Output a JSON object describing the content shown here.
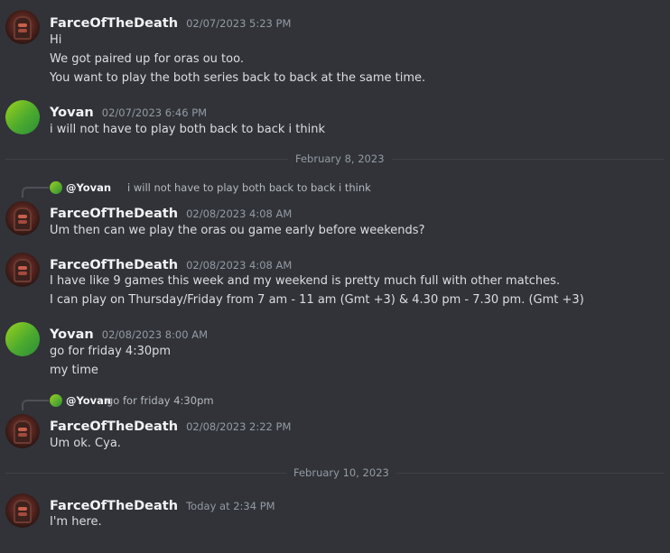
{
  "messages": {
    "m1": {
      "author": "FarceOfTheDeath",
      "timestamp": "02/07/2023 5:23 PM",
      "lines": [
        "Hi",
        "We got paired up for oras ou too.",
        "You want to play the both series back to back at the same time."
      ]
    },
    "m2": {
      "author": "Yovan",
      "timestamp": "02/07/2023 6:46 PM",
      "lines": [
        "i will not have to play both back to back i think"
      ]
    },
    "m3": {
      "reply": {
        "author": "@Yovan",
        "text": "i will not have to play both back to back i think"
      },
      "author": "FarceOfTheDeath",
      "timestamp": "02/08/2023 4:08 AM",
      "lines": [
        "Um then can we play the oras ou game early before weekends?"
      ]
    },
    "m4": {
      "author": "FarceOfTheDeath",
      "timestamp": "02/08/2023 4:08 AM",
      "lines": [
        "I have like 9 games this week and my weekend is pretty much full with other matches.",
        "I can play on Thursday/Friday from 7 am - 11 am (Gmt +3) & 4.30 pm - 7.30 pm. (Gmt +3)"
      ]
    },
    "m5": {
      "author": "Yovan",
      "timestamp": "02/08/2023 8:00 AM",
      "lines": [
        "go for friday 4:30pm",
        "my time"
      ]
    },
    "m6": {
      "reply": {
        "author": "@Yovan",
        "text": "go for friday 4:30pm"
      },
      "author": "FarceOfTheDeath",
      "timestamp": "02/08/2023 2:22 PM",
      "lines": [
        "Um ok. Cya."
      ]
    },
    "m7": {
      "author": "FarceOfTheDeath",
      "timestamp": "Today at 2:34 PM",
      "lines": [
        "I'm here."
      ]
    }
  },
  "dividers": {
    "d1": "February 8, 2023",
    "d2": "February 10, 2023"
  },
  "colors": {
    "background": "#313338",
    "author": "#f2f3f5",
    "text": "#dbdee1",
    "timestamp": "#949ba4"
  }
}
